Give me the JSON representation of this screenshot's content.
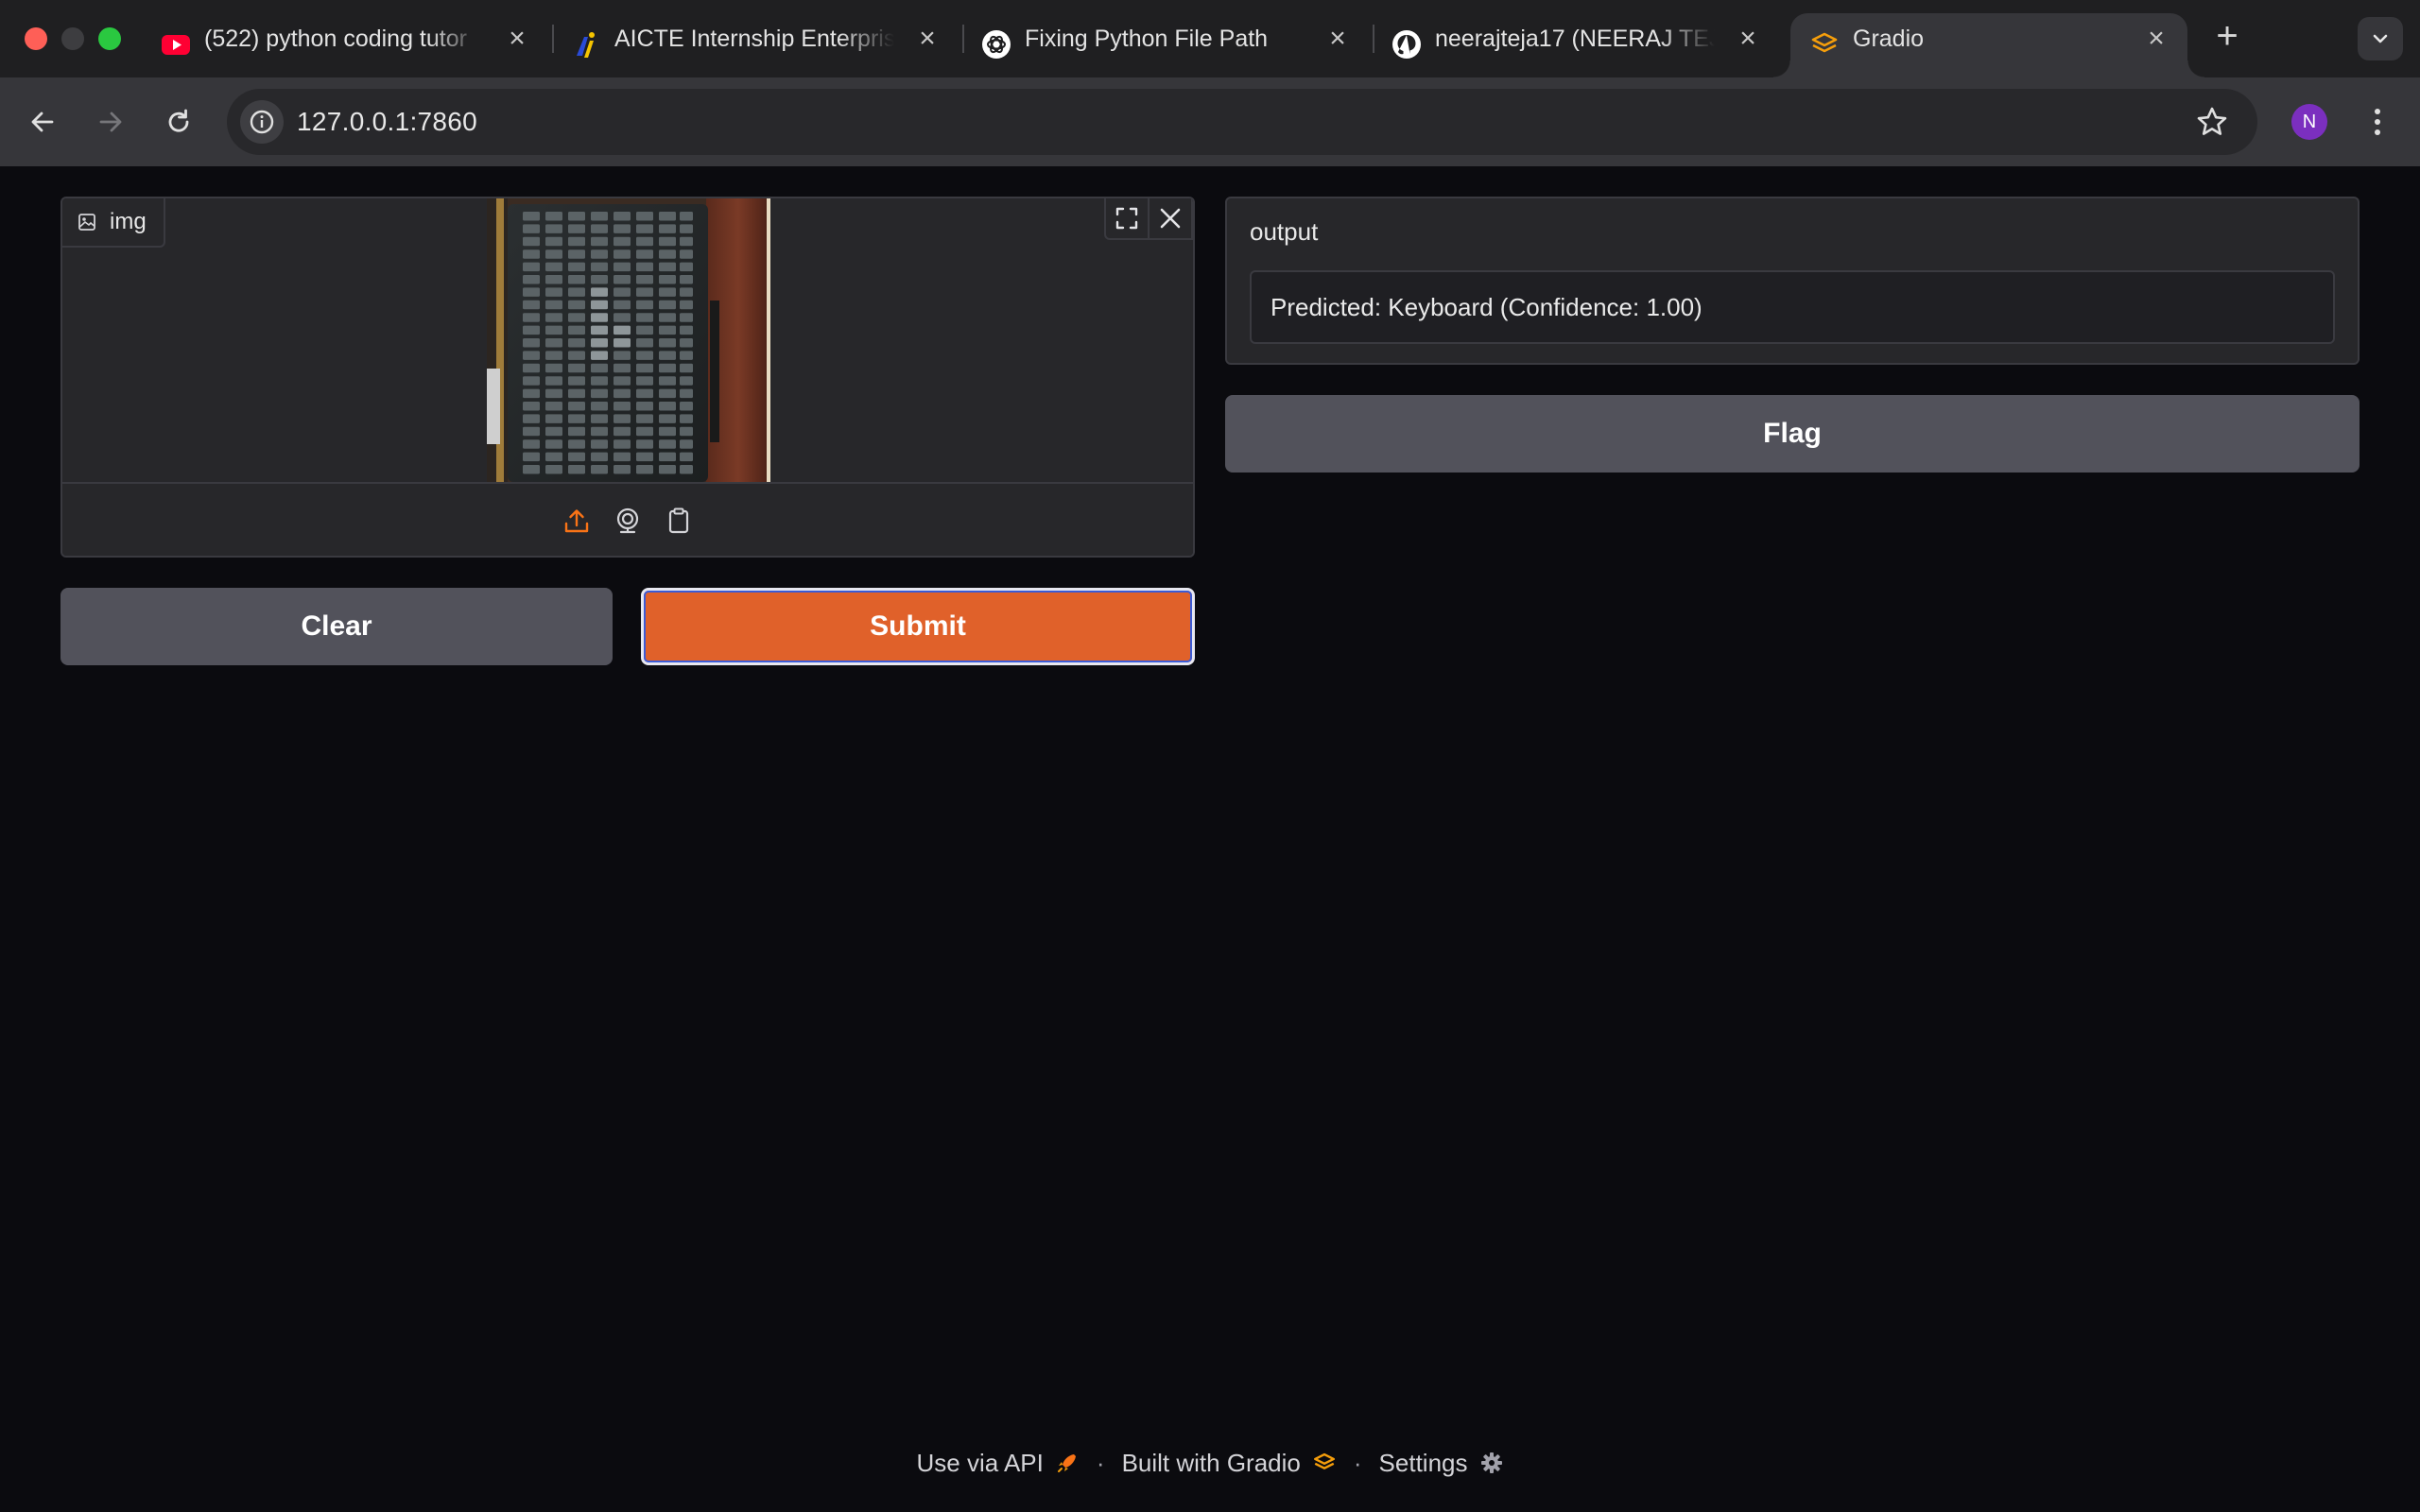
{
  "browser": {
    "tabs": [
      {
        "title": "(522) python coding tutor",
        "favicon": "youtube-icon"
      },
      {
        "title": "AICTE Internship Enterpris",
        "favicon": "aicte-logo-icon"
      },
      {
        "title": "Fixing Python File Path",
        "favicon": "openai-icon"
      },
      {
        "title": "neerajteja17 (NEERAJ TEJ",
        "favicon": "github-icon"
      },
      {
        "title": "Gradio",
        "favicon": "gradio-icon",
        "active": true
      }
    ],
    "url": "127.0.0.1:7860",
    "profile_initial": "N"
  },
  "app": {
    "input": {
      "label": "img",
      "sources": [
        "upload-icon",
        "webcam-icon",
        "clipboard-icon"
      ]
    },
    "buttons": {
      "clear": "Clear",
      "submit": "Submit",
      "flag": "Flag"
    },
    "output": {
      "label": "output",
      "value": "Predicted: Keyboard (Confidence: 1.00)"
    },
    "footer": {
      "api": "Use via API",
      "built": "Built with Gradio",
      "settings": "Settings"
    }
  },
  "colors": {
    "accent": "#e0612a",
    "secondary_button": "#52525b",
    "page_background": "#0b0b0f"
  }
}
